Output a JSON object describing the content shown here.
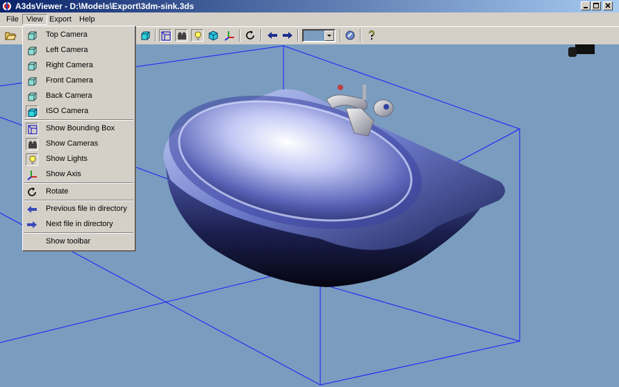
{
  "window": {
    "title": "A3dsViewer - D:\\Models\\Export\\3dm-sink.3ds",
    "controls": [
      "minimize",
      "maximize",
      "close"
    ]
  },
  "menubar": {
    "items": [
      {
        "label": "File"
      },
      {
        "label": "View",
        "open": true
      },
      {
        "label": "Export"
      },
      {
        "label": "Help"
      }
    ]
  },
  "toolbar": {
    "buttons": [
      "open-folder-icon",
      "camera-top-icon",
      "camera-iso-icon",
      "bounding-box-icon",
      "cameras-icon",
      "lights-icon",
      "axis-icon",
      "rotate-icon",
      "previous-arrow-icon",
      "next-arrow-icon",
      "color-combo",
      "search-icon",
      "help-icon"
    ],
    "combo_color": "#7a9cbf"
  },
  "view_menu": {
    "items": [
      {
        "label": "Top Camera",
        "icon": "camera-cube-icon"
      },
      {
        "label": "Left Camera",
        "icon": "camera-cube-icon"
      },
      {
        "label": "Right Camera",
        "icon": "camera-cube-icon"
      },
      {
        "label": "Front Camera",
        "icon": "camera-cube-icon"
      },
      {
        "label": "Back Camera",
        "icon": "camera-cube-icon"
      },
      {
        "label": "ISO Camera",
        "icon": "iso-cube-icon",
        "checked": true
      },
      {
        "label": "Show Bounding Box",
        "icon": "bounding-box-icon",
        "checked": true
      },
      {
        "label": "Show Cameras",
        "icon": "cameras-icon",
        "checked": true
      },
      {
        "label": "Show Lights",
        "icon": "lights-icon",
        "checked": true
      },
      {
        "label": "Show Axis",
        "icon": "axis-icon"
      },
      {
        "label": "Rotate",
        "icon": "rotate-icon"
      },
      {
        "label": "Previous file in directory",
        "icon": "previous-arrow-icon"
      },
      {
        "label": "Next file in directory",
        "icon": "next-arrow-icon"
      },
      {
        "label": "Show toolbar",
        "icon": ""
      }
    ]
  },
  "viewport": {
    "background": "#7a9cbf",
    "bounding_box_color": "#1a1aff",
    "model": "sink"
  }
}
